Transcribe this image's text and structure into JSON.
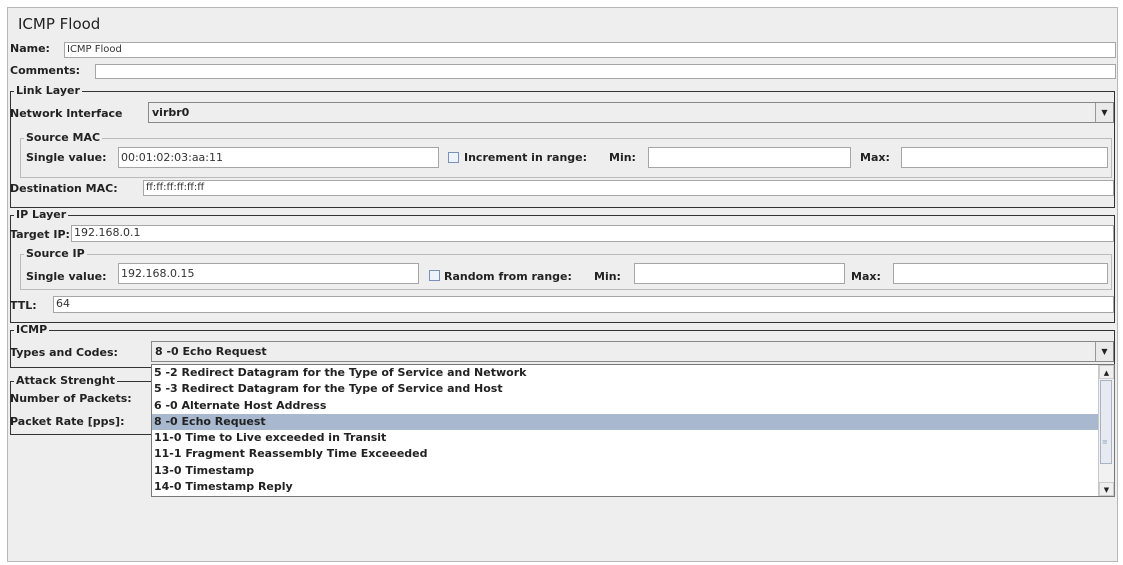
{
  "title": "ICMP Flood",
  "name": {
    "label": "Name:",
    "value": "ICMP Flood"
  },
  "comments": {
    "label": "Comments:",
    "value": ""
  },
  "link_layer": {
    "legend": "Link Layer",
    "interface_label": "Network Interface",
    "interface_value": "virbr0",
    "source_mac": {
      "legend": "Source MAC",
      "single_label": "Single value:",
      "single_value": "00:01:02:03:aa:11",
      "increment_label": "Increment in range:",
      "min_label": "Min:",
      "min_value": "",
      "max_label": "Max:",
      "max_value": ""
    },
    "dest_mac_label": "Destination MAC:",
    "dest_mac_value": "ff:ff:ff:ff:ff:ff"
  },
  "ip_layer": {
    "legend": "IP Layer",
    "target_label": "Target IP:",
    "target_value": "192.168.0.1",
    "source_ip": {
      "legend": "Source IP",
      "single_label": "Single value:",
      "single_value": "192.168.0.15",
      "random_label": "Random from range:",
      "min_label": "Min:",
      "min_value": "",
      "max_label": "Max:",
      "max_value": ""
    },
    "ttl_label": "TTL:",
    "ttl_value": "64"
  },
  "icmp": {
    "legend": "ICMP",
    "types_label": "Types and Codes:",
    "selected": "8 -0 Echo Request",
    "options": [
      "5 -2 Redirect Datagram for the Type of Service and Network",
      "5 -3 Redirect Datagram for the Type of Service and Host",
      "6 -0 Alternate Host Address",
      "8 -0 Echo Request",
      "11-0 Time to Live exceeded in Transit",
      "11-1 Fragment Reassembly Time Exceeeded",
      "13-0 Timestamp",
      "14-0 Timestamp Reply"
    ]
  },
  "attack": {
    "legend": "Attack Strenght",
    "packets_label": "Number of Packets:",
    "rate_label": "Packet Rate [pps]:"
  }
}
